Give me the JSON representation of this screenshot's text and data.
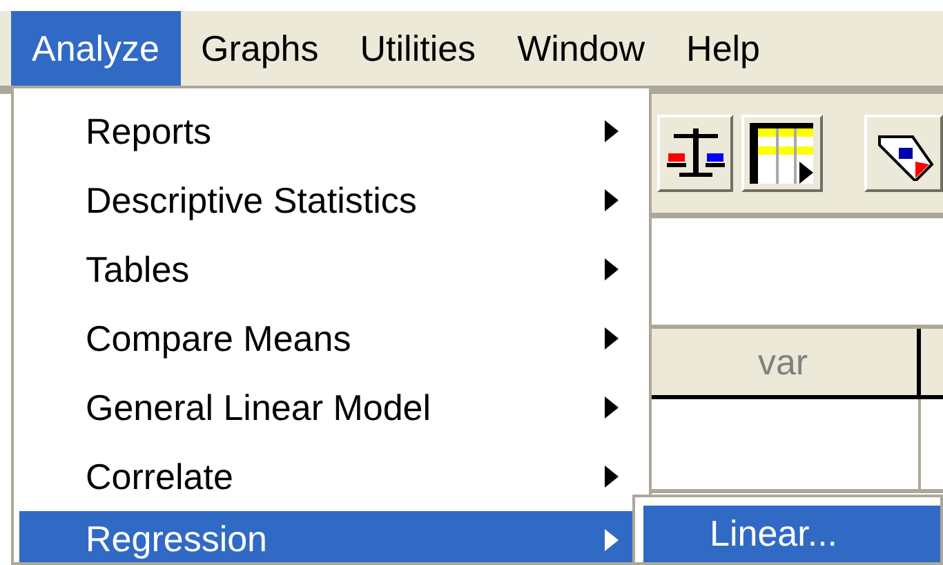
{
  "menubar": [
    {
      "label": "Analyze",
      "selected": true
    },
    {
      "label": "Graphs",
      "selected": false
    },
    {
      "label": "Utilities",
      "selected": false
    },
    {
      "label": "Window",
      "selected": false
    },
    {
      "label": "Help",
      "selected": false
    }
  ],
  "menu": {
    "items": [
      {
        "label": "Reports",
        "has_submenu": true,
        "selected": false
      },
      {
        "label": "Descriptive Statistics",
        "has_submenu": true,
        "selected": false
      },
      {
        "label": "Tables",
        "has_submenu": true,
        "selected": false
      },
      {
        "label": "Compare Means",
        "has_submenu": true,
        "selected": false
      },
      {
        "label": "General Linear Model",
        "has_submenu": true,
        "selected": false
      },
      {
        "label": "Correlate",
        "has_submenu": true,
        "selected": false
      },
      {
        "label": "Regression",
        "has_submenu": true,
        "selected": true
      }
    ]
  },
  "submenu": {
    "items": [
      {
        "label": "Linear...",
        "selected": true
      }
    ]
  },
  "grid": {
    "columns": [
      "var"
    ]
  }
}
